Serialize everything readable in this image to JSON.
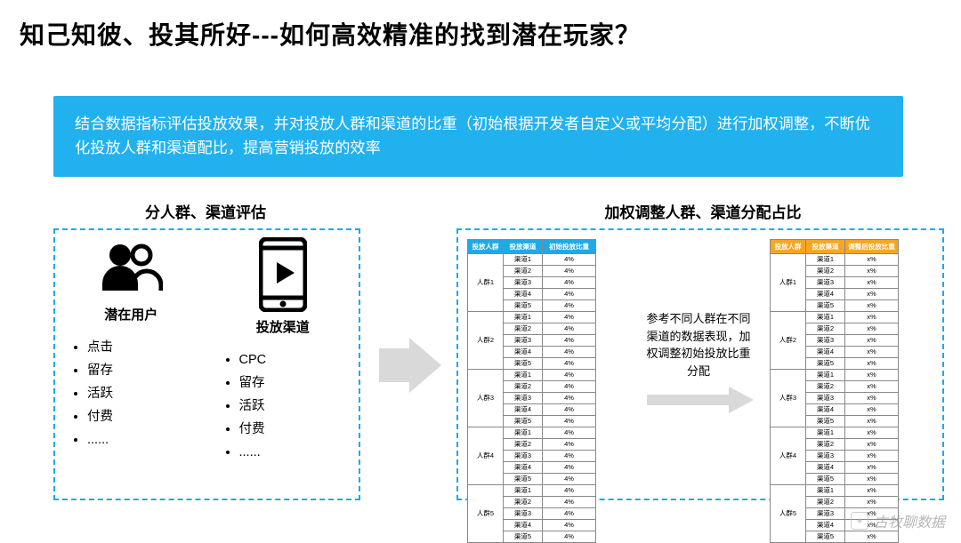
{
  "title": "知己知彼、投其所好---如何高效精准的找到潜在玩家？",
  "blue_box": "结合数据指标评估投放效果，并对投放人群和渠道的比重（初始根据开发者自定义或平均分配）进行加权调整，不断优化投放人群和渠道配比，提高营销投放的效率",
  "left_section_title": "分人群、渠道评估",
  "right_section_title": "加权调整人群、渠道分配占比",
  "left_col1": {
    "label": "潜在用户",
    "bullets": [
      "点击",
      "留存",
      "活跃",
      "付费",
      "......"
    ]
  },
  "left_col2": {
    "label": "投放渠道",
    "bullets": [
      "CPC",
      "留存",
      "活跃",
      "付费",
      "......"
    ]
  },
  "mid_text": "参考不同人群在不同渠道的数据表现，加权调整初始投放比重分配",
  "table_left": {
    "headers": [
      "投放人群",
      "投放渠道",
      "初始投放比重"
    ],
    "groups": [
      "人群1",
      "人群2",
      "人群3",
      "人群4",
      "人群5"
    ],
    "channels": [
      "渠道1",
      "渠道2",
      "渠道3",
      "渠道4",
      "渠道5"
    ],
    "value": "4%"
  },
  "table_right": {
    "headers": [
      "投放人群",
      "投放渠道",
      "调整后投放比重"
    ],
    "groups": [
      "人群1",
      "人群2",
      "人群3",
      "人群4",
      "人群5"
    ],
    "channels": [
      "渠道1",
      "渠道2",
      "渠道3",
      "渠道4",
      "渠道5"
    ],
    "value": "x%"
  },
  "watermark": "古牧聊数据"
}
